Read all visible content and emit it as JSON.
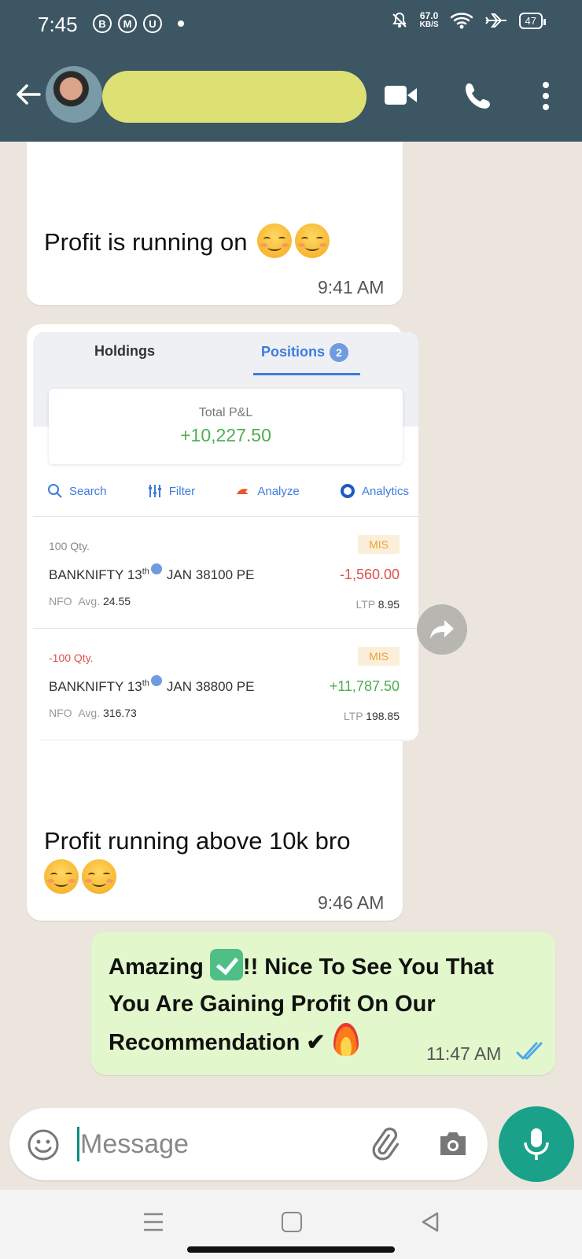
{
  "status_bar": {
    "time": "7:45",
    "left_icons": [
      "B",
      "M",
      "U"
    ],
    "network_speed_value": "67.0",
    "network_speed_unit": "KB/S",
    "battery": "47"
  },
  "header": {
    "contact_name": "",
    "icons": [
      "back-arrow-icon",
      "video-call-icon",
      "voice-call-icon",
      "more-options-icon"
    ]
  },
  "messages": [
    {
      "direction": "incoming",
      "text": "Profit is running on",
      "emoji_count": 2,
      "time": "9:41 AM"
    },
    {
      "direction": "incoming",
      "type": "image",
      "caption": "Profit running above 10k bro",
      "emoji_count": 2,
      "time": "9:46 AM",
      "screenshot": {
        "tabs": {
          "holdings": "Holdings",
          "positions": "Positions",
          "positions_count": "2"
        },
        "total_pnl_label": "Total P&L",
        "total_pnl_value": "+10,227.50",
        "toolbar": {
          "search": "Search",
          "filter": "Filter",
          "analyze": "Analyze",
          "analytics": "Analytics"
        },
        "positions": [
          {
            "qty": "100 Qty.",
            "name_prefix": "BANKNIFTY 13",
            "name_suffix": "th",
            "name_rest": "JAN 38100 PE",
            "exchange": "NFO",
            "avg_label": "Avg.",
            "avg": "24.55",
            "product": "MIS",
            "pnl": "-1,560.00",
            "ltp_label": "LTP",
            "ltp": "8.95"
          },
          {
            "qty": "-100 Qty.",
            "name_prefix": "BANKNIFTY 13",
            "name_suffix": "th",
            "name_rest": "JAN 38800 PE",
            "exchange": "NFO",
            "avg_label": "Avg.",
            "avg": "316.73",
            "product": "MIS",
            "pnl": "+11,787.50",
            "ltp_label": "LTP",
            "ltp": "198.85"
          }
        ]
      }
    },
    {
      "direction": "outgoing",
      "text_part1": "Amazing",
      "text_part2": "!! Nice   To See You That You Are Gaining Profit On  Our Recommendation",
      "check_mark": "✔",
      "time": "11:47 AM",
      "status": "read"
    }
  ],
  "composer": {
    "placeholder": "Message"
  },
  "colors": {
    "header": "#3D5663",
    "outgoing_bubble": "#E2F7CB",
    "accent": "#1AA189",
    "gain": "#4CAF50",
    "loss": "#D9534F"
  }
}
